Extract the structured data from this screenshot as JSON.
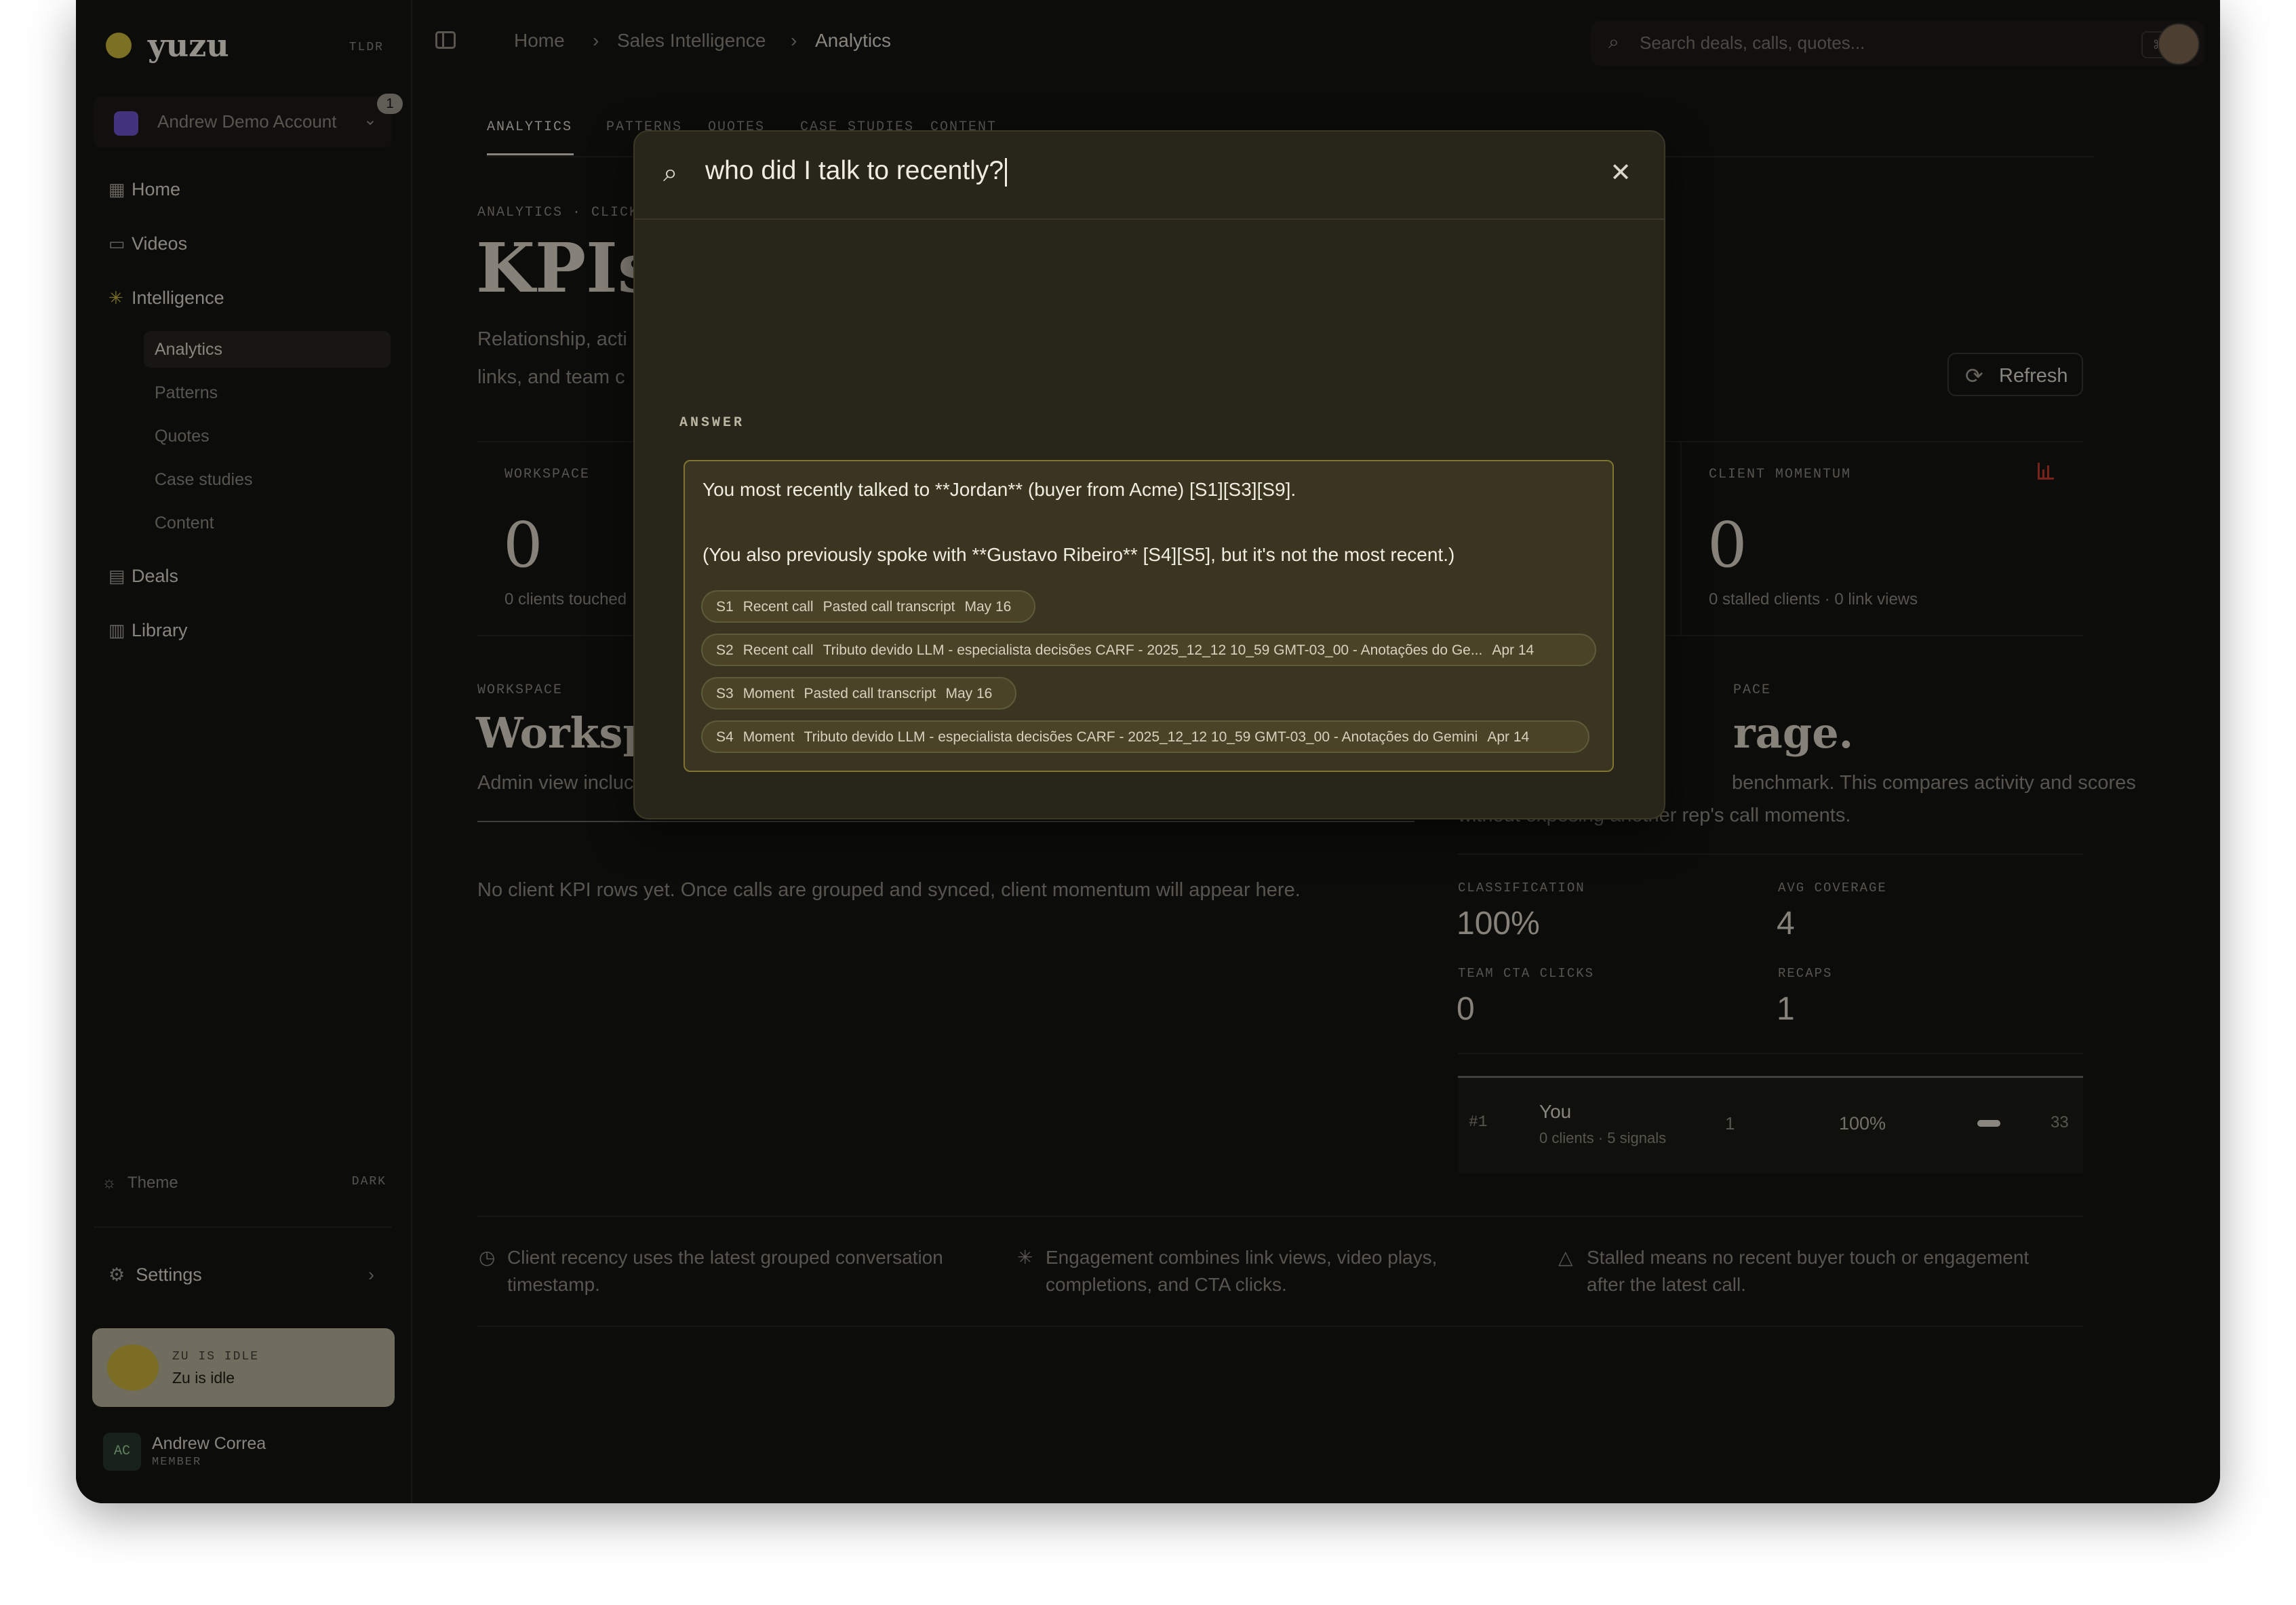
{
  "app": {
    "name": "yuzu",
    "mode_tag": "TLDR"
  },
  "account": {
    "name": "Andrew Demo Account",
    "badge": "1"
  },
  "sidebar": {
    "items": [
      {
        "label": "Home",
        "icon": "grid-icon"
      },
      {
        "label": "Videos",
        "icon": "video-icon"
      },
      {
        "label": "Intelligence",
        "icon": "sparkle-icon"
      },
      {
        "label": "Deals",
        "icon": "briefcase-icon"
      },
      {
        "label": "Library",
        "icon": "books-icon"
      }
    ],
    "sub_items": [
      "Analytics",
      "Patterns",
      "Quotes",
      "Case studies",
      "Content"
    ],
    "theme_label": "Theme",
    "theme_value": "DARK",
    "settings_label": "Settings",
    "zu_status_tag": "ZU IS IDLE",
    "zu_status_text": "Zu is idle",
    "user": {
      "initials": "AC",
      "name": "Andrew Correa",
      "role": "MEMBER"
    }
  },
  "breadcrumb": [
    "Home",
    "Sales Intelligence",
    "Analytics"
  ],
  "search": {
    "placeholder": "Search deals, calls, quotes...",
    "shortcut": "⌘ K"
  },
  "tabs": [
    "ANALYTICS",
    "PATTERNS",
    "QUOTES",
    "CASE STUDIES",
    "CONTENT"
  ],
  "main": {
    "eyebrow": "ANALYTICS · CLICK",
    "title": "KPIs",
    "desc_line1": "Relationship, acti",
    "desc_line2": "links, and team c",
    "refresh_label": "Refresh",
    "kpi_workspace": {
      "label": "WORKSPACE",
      "value": "0",
      "sub": "0 clients touched"
    },
    "kpi_momentum": {
      "label": "CLIENT MOMENTUM",
      "value": "0",
      "sub": "0 stalled clients · 0 link views"
    },
    "section_left": {
      "eyebrow": "WORKSPACE",
      "title": "Worksp",
      "desc": "Admin view incluc"
    },
    "section_right": {
      "eyebrow": "PACE",
      "title": "rage.",
      "desc_line1": "benchmark. This compares activity and scores",
      "desc_line2": "without exposing another rep's call moments."
    },
    "empty_text": "No client KPI rows yet. Once calls are grouped and synced, client momentum will appear here.",
    "stats": [
      {
        "label": "CLASSIFICATION",
        "value": "100%"
      },
      {
        "label": "AVG COVERAGE",
        "value": "4"
      },
      {
        "label": "TEAM CTA CLICKS",
        "value": "0"
      },
      {
        "label": "RECAPS",
        "value": "1"
      }
    ],
    "leaderboard": {
      "rank": "#1",
      "name": "You",
      "sub": "0 clients · 5 signals",
      "calls": "1",
      "pct": "100%",
      "bar_fraction": 1.0,
      "score": "33"
    },
    "footnotes": [
      {
        "icon": "clock-icon",
        "line1": "Client recency uses the latest grouped conversation",
        "line2": "timestamp."
      },
      {
        "icon": "sparkle-icon",
        "line1": "Engagement combines link views, video plays,",
        "line2": "completions, and CTA clicks."
      },
      {
        "icon": "warning-icon",
        "line1": "Stalled means no recent buyer touch or engagement",
        "line2": "after the latest call."
      }
    ]
  },
  "modal": {
    "query": "who did I talk to recently?",
    "answer_label": "ANSWER",
    "answer_line1": "You most recently talked to **Jordan** (buyer from Acme) [S1][S3][S9].",
    "answer_line2": "(You also previously spoke with **Gustavo Ribeiro** [S4][S5], but it's not the most recent.)",
    "citations": [
      {
        "id": "S1",
        "kind": "Recent call",
        "title": "Pasted call transcript",
        "date": "May 16"
      },
      {
        "id": "S2",
        "kind": "Recent call",
        "title": "Tributo devido LLM - especialista decisões CARF - 2025_12_12 10_59 GMT-03_00 - Anotações do Ge...",
        "date": "Apr 14"
      },
      {
        "id": "S3",
        "kind": "Moment",
        "title": "Pasted call transcript",
        "date": "May 16"
      },
      {
        "id": "S4",
        "kind": "Moment",
        "title": "Tributo devido LLM - especialista decisões CARF - 2025_12_12 10_59 GMT-03_00 - Anotações do Gemini",
        "date": "Apr 14"
      }
    ]
  },
  "colors": {
    "accent": "#c9b53b",
    "background": "#141411",
    "modal": "#28261a",
    "alert": "#c0392b"
  }
}
